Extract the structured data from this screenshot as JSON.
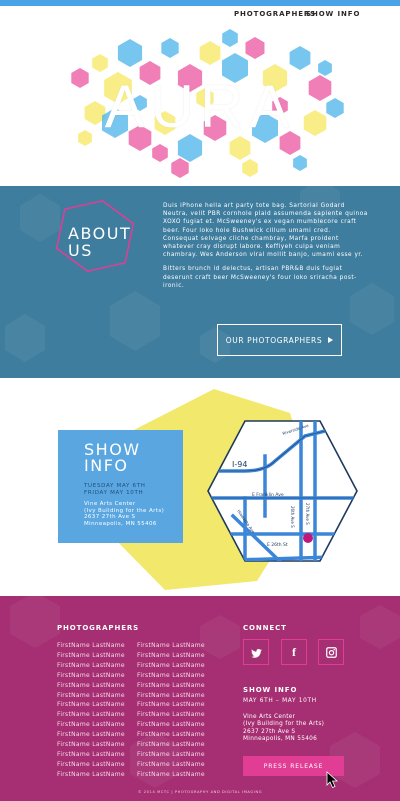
{
  "nav": {
    "items": [
      "PHOTOGRAPHERS",
      "SHOW INFO"
    ]
  },
  "hero": {
    "title": "AURA"
  },
  "about": {
    "heading_line1": "ABOUT",
    "heading_line2": "US",
    "paragraph1": "Duis iPhone hella art party tote bag. Sartorial Godard Neutra, velit PBR cornhole plaid assumenda sapiente quinoa XOXO fugiat et. McSweeney's ex vegan mumblecore craft beer. Four loko hoie Bushwick cillum umami cred. Consequat selvage cliche chambray, Marfa proident whatever cray disrupt labore. Keffiyeh culpa veniam chambray. Wes Anderson viral mollit banjo, umami esse yr.",
    "paragraph2": "Bitters brunch id delectus, artisan PBR&B duis fugiat deserunt craft beer McSweeney's four loko sriracha post-ironic.",
    "button_label": "OUR PHOTOGRAPHERS"
  },
  "show": {
    "title_line1": "SHOW",
    "title_line2": "INFO",
    "date_line1": "TUESDAY MAY 6TH",
    "date_line2": "FRIDAY MAY 10TH",
    "venue_line1": "Vine Arts Center",
    "venue_line2": "(Ivy Building for the Arts)",
    "venue_line3": "2637 27th Ave S",
    "venue_line4": "Minneapolis, MN 55406",
    "map": {
      "label_i94": "I-94",
      "label_riverside": "Riverside Ave",
      "label_franklin": "E Franklin Ave",
      "label_hiawatha": "Hiawatha Ave",
      "label_26thave": "26th Ave S",
      "label_27thave": "27th Ave S",
      "label_26thst": "E 26th St"
    }
  },
  "footer": {
    "photographers_heading": "PHOTOGRAPHERS",
    "names_col1": [
      "FirstName LastName",
      "FirstName LastName",
      "FirstName LastName",
      "FirstName LastName",
      "FirstName LastName",
      "FirstName LastName",
      "FirstName LastName",
      "FirstName LastName",
      "FirstName LastName",
      "FirstName LastName",
      "FirstName LastName",
      "FirstName LastName",
      "FirstName LastName",
      "FirstName LastName"
    ],
    "names_col2": [
      "FirstName LastName",
      "FirstName LastName",
      "FirstName LastName",
      "FirstName LastName",
      "FirstName LastName",
      "FirstName LastName",
      "FirstName LastName",
      "FirstName LastName",
      "FirstName LastName",
      "FirstName LastName",
      "FirstName LastName",
      "FirstName LastName",
      "FirstName LastName",
      "FirstName LastName"
    ],
    "connect_heading": "CONNECT",
    "social_icons": [
      "twitter-icon",
      "facebook-icon",
      "instagram-icon"
    ],
    "show_heading": "SHOW INFO",
    "dates": "MAY 6TH – MAY 10TH",
    "venue_line1": "Vine Arts Center",
    "venue_line2": "(Ivy Building for the Arts)",
    "venue_line3": "2637 27th Ave S",
    "venue_line4": "Minneapolis, MN 55406",
    "press_button": "PRESS RELEASE",
    "copyright": "© 2014 MCTC | PHOTOGRAPHY AND DIGITAL IMAGING"
  },
  "colors": {
    "top_bar": "#4aa3e6",
    "about_bg": "#3f7d9e",
    "show_box": "#5aa6e0",
    "yellow": "#f2e86c",
    "footer_bg": "#a52f72",
    "accent_pink": "#e23d95"
  }
}
